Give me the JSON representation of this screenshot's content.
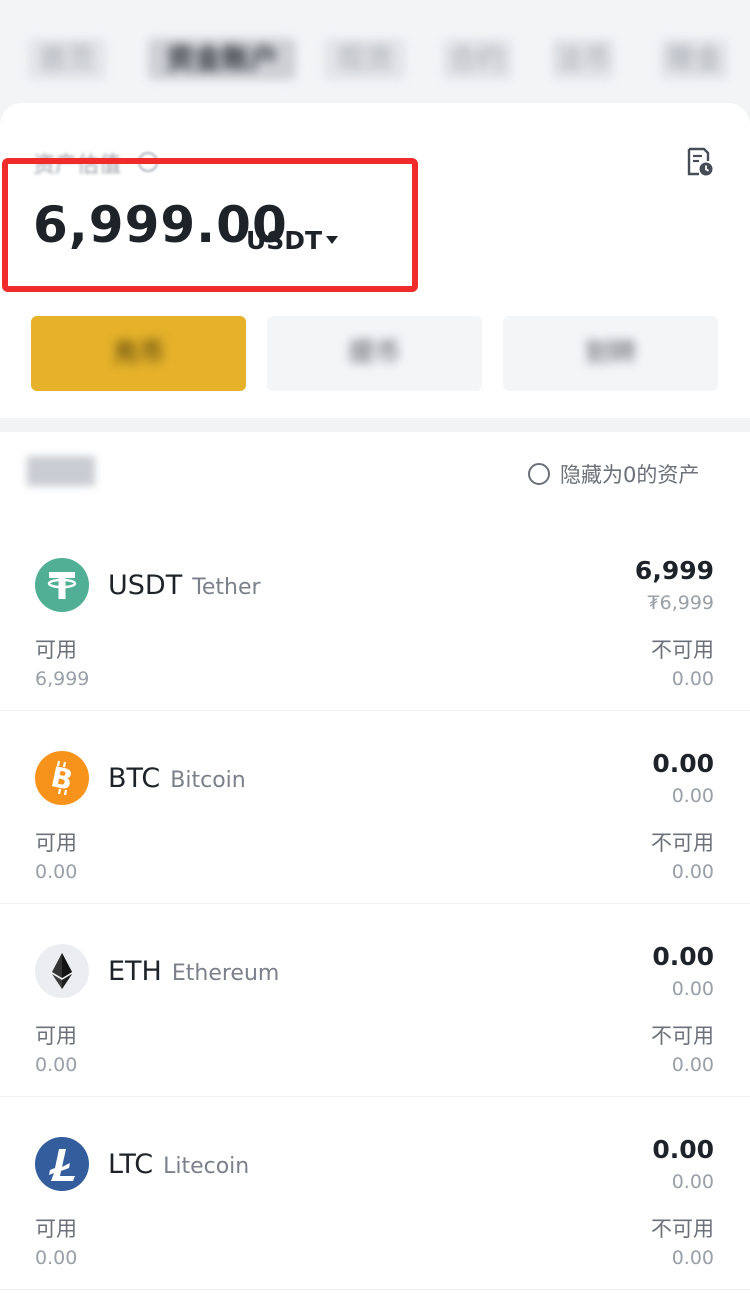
{
  "nav": {
    "tabs": [
      "首页",
      "资金账户",
      "现货",
      "合约",
      "法币",
      "赠金"
    ]
  },
  "summary": {
    "label": "资产估值",
    "total_value": "6,999.00",
    "unit": "USDT",
    "actions": [
      "充币",
      "提币",
      "划转"
    ]
  },
  "list": {
    "header_label": "资产",
    "hide_zero_label": "隐藏为0的资产",
    "available_label": "可用",
    "unavailable_label": "不可用",
    "assets": [
      {
        "symbol": "USDT",
        "name": "Tether",
        "total": "6,999",
        "fiat": "₮6,999",
        "available": "6,999",
        "unavailable": "0.00",
        "icon": "tether-icon",
        "color": "#50af95"
      },
      {
        "symbol": "BTC",
        "name": "Bitcoin",
        "total": "0.00",
        "fiat": "0.00",
        "available": "0.00",
        "unavailable": "0.00",
        "icon": "bitcoin-icon",
        "color": "#f7931a"
      },
      {
        "symbol": "ETH",
        "name": "Ethereum",
        "total": "0.00",
        "fiat": "0.00",
        "available": "0.00",
        "unavailable": "0.00",
        "icon": "ethereum-icon",
        "color": "#ecedf0"
      },
      {
        "symbol": "LTC",
        "name": "Litecoin",
        "total": "0.00",
        "fiat": "0.00",
        "available": "0.00",
        "unavailable": "0.00",
        "icon": "litecoin-icon",
        "color": "#345d9d"
      }
    ]
  },
  "colors": {
    "primary_button": "#e5b22a",
    "highlight_box": "#ef2b2b"
  }
}
